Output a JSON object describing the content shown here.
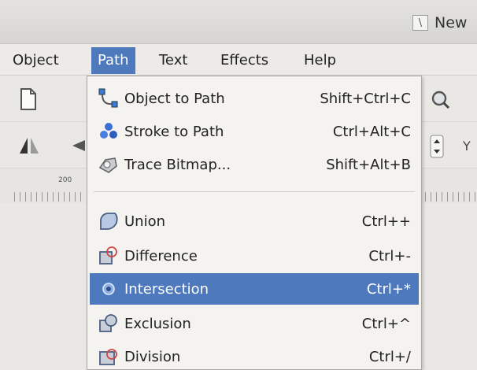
{
  "window": {
    "title": "New",
    "icon": "inkscape-app-icon"
  },
  "menubar": {
    "items": [
      {
        "label": "Object",
        "active": false
      },
      {
        "label": "Path",
        "active": true
      },
      {
        "label": "Text",
        "active": false
      },
      {
        "label": "Effects",
        "active": false
      },
      {
        "label": "Help",
        "active": false
      }
    ]
  },
  "ruler": {
    "label": "200"
  },
  "toolbar": {
    "partial_label": "Y"
  },
  "path_menu": {
    "groups": [
      [
        {
          "label": "Object to Path",
          "shortcut": "Shift+Ctrl+C",
          "icon": "object-to-path-icon"
        },
        {
          "label": "Stroke to Path",
          "shortcut": "Ctrl+Alt+C",
          "icon": "stroke-to-path-icon"
        },
        {
          "label": "Trace Bitmap...",
          "shortcut": "Shift+Alt+B",
          "icon": "trace-bitmap-icon"
        }
      ],
      [
        {
          "label": "Union",
          "shortcut": "Ctrl++",
          "icon": "union-icon"
        },
        {
          "label": "Difference",
          "shortcut": "Ctrl+-",
          "icon": "difference-icon"
        },
        {
          "label": "Intersection",
          "shortcut": "Ctrl+*",
          "icon": "intersection-icon",
          "highlighted": true
        },
        {
          "label": "Exclusion",
          "shortcut": "Ctrl+^",
          "icon": "exclusion-icon"
        },
        {
          "label": "Division",
          "shortcut": "Ctrl+/",
          "icon": "division-icon"
        }
      ]
    ]
  },
  "colors": {
    "highlight": "#4e79bd",
    "menu_bg": "#f4f3f0",
    "window_bg": "#e9e8e4"
  }
}
